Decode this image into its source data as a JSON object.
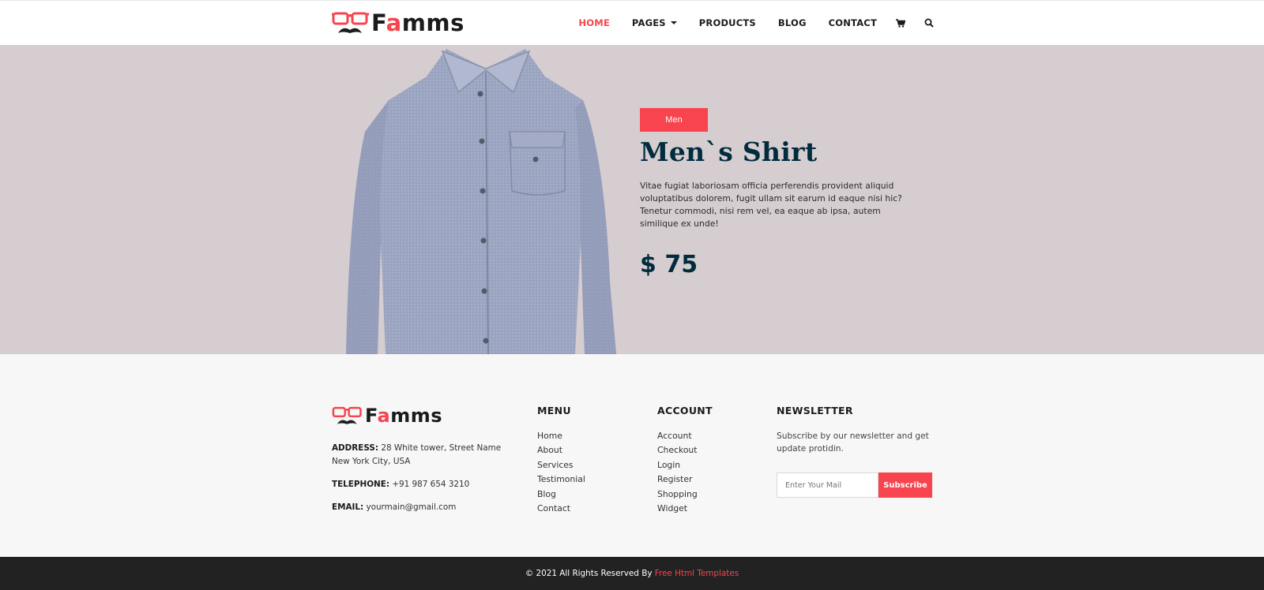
{
  "brand": {
    "name_prefix": "F",
    "name_highlight": "a",
    "name_suffix": "mms"
  },
  "nav": {
    "items": [
      {
        "label": "Home",
        "active": true
      },
      {
        "label": "Pages",
        "has_caret": true
      },
      {
        "label": "Products"
      },
      {
        "label": "Blog"
      },
      {
        "label": "Contact"
      }
    ],
    "cart_icon": "cart-icon",
    "search_icon": "search-icon"
  },
  "hero": {
    "badge": "Men",
    "title": "Men`s Shirt",
    "description": "Vitae fugiat laboriosam officia perferendis provident aliquid voluptatibus dolorem, fugit ullam sit earum id eaque nisi hic? Tenetur commodi, nisi rem vel, ea eaque ab ipsa, autem similique ex unde!",
    "price": "$ 75"
  },
  "footer": {
    "address_label": "ADDRESS:",
    "address": "28 White tower, Street Name New York City, USA",
    "telephone_label": "TELEPHONE:",
    "telephone": "+91 987 654 3210",
    "email_label": "EMAIL:",
    "email": "yourmain@gmail.com",
    "menu": {
      "heading": "MENU",
      "items": [
        "Home",
        "About",
        "Services",
        "Testimonial",
        "Blog",
        "Contact"
      ]
    },
    "account": {
      "heading": "ACCOUNT",
      "items": [
        "Account",
        "Checkout",
        "Login",
        "Register",
        "Shopping",
        "Widget"
      ]
    },
    "newsletter": {
      "heading": "NEWSLETTER",
      "text": "Subscribe by our newsletter and get update protidin.",
      "placeholder": "Enter Your Mail",
      "button": "Subscribe"
    }
  },
  "copyright": {
    "text": "© 2021 All Rights Reserved By ",
    "link": "Free Html Templates"
  },
  "colors": {
    "accent": "#f7444e",
    "dark": "#002c3e",
    "hero_bg": "#d5cdd0"
  }
}
